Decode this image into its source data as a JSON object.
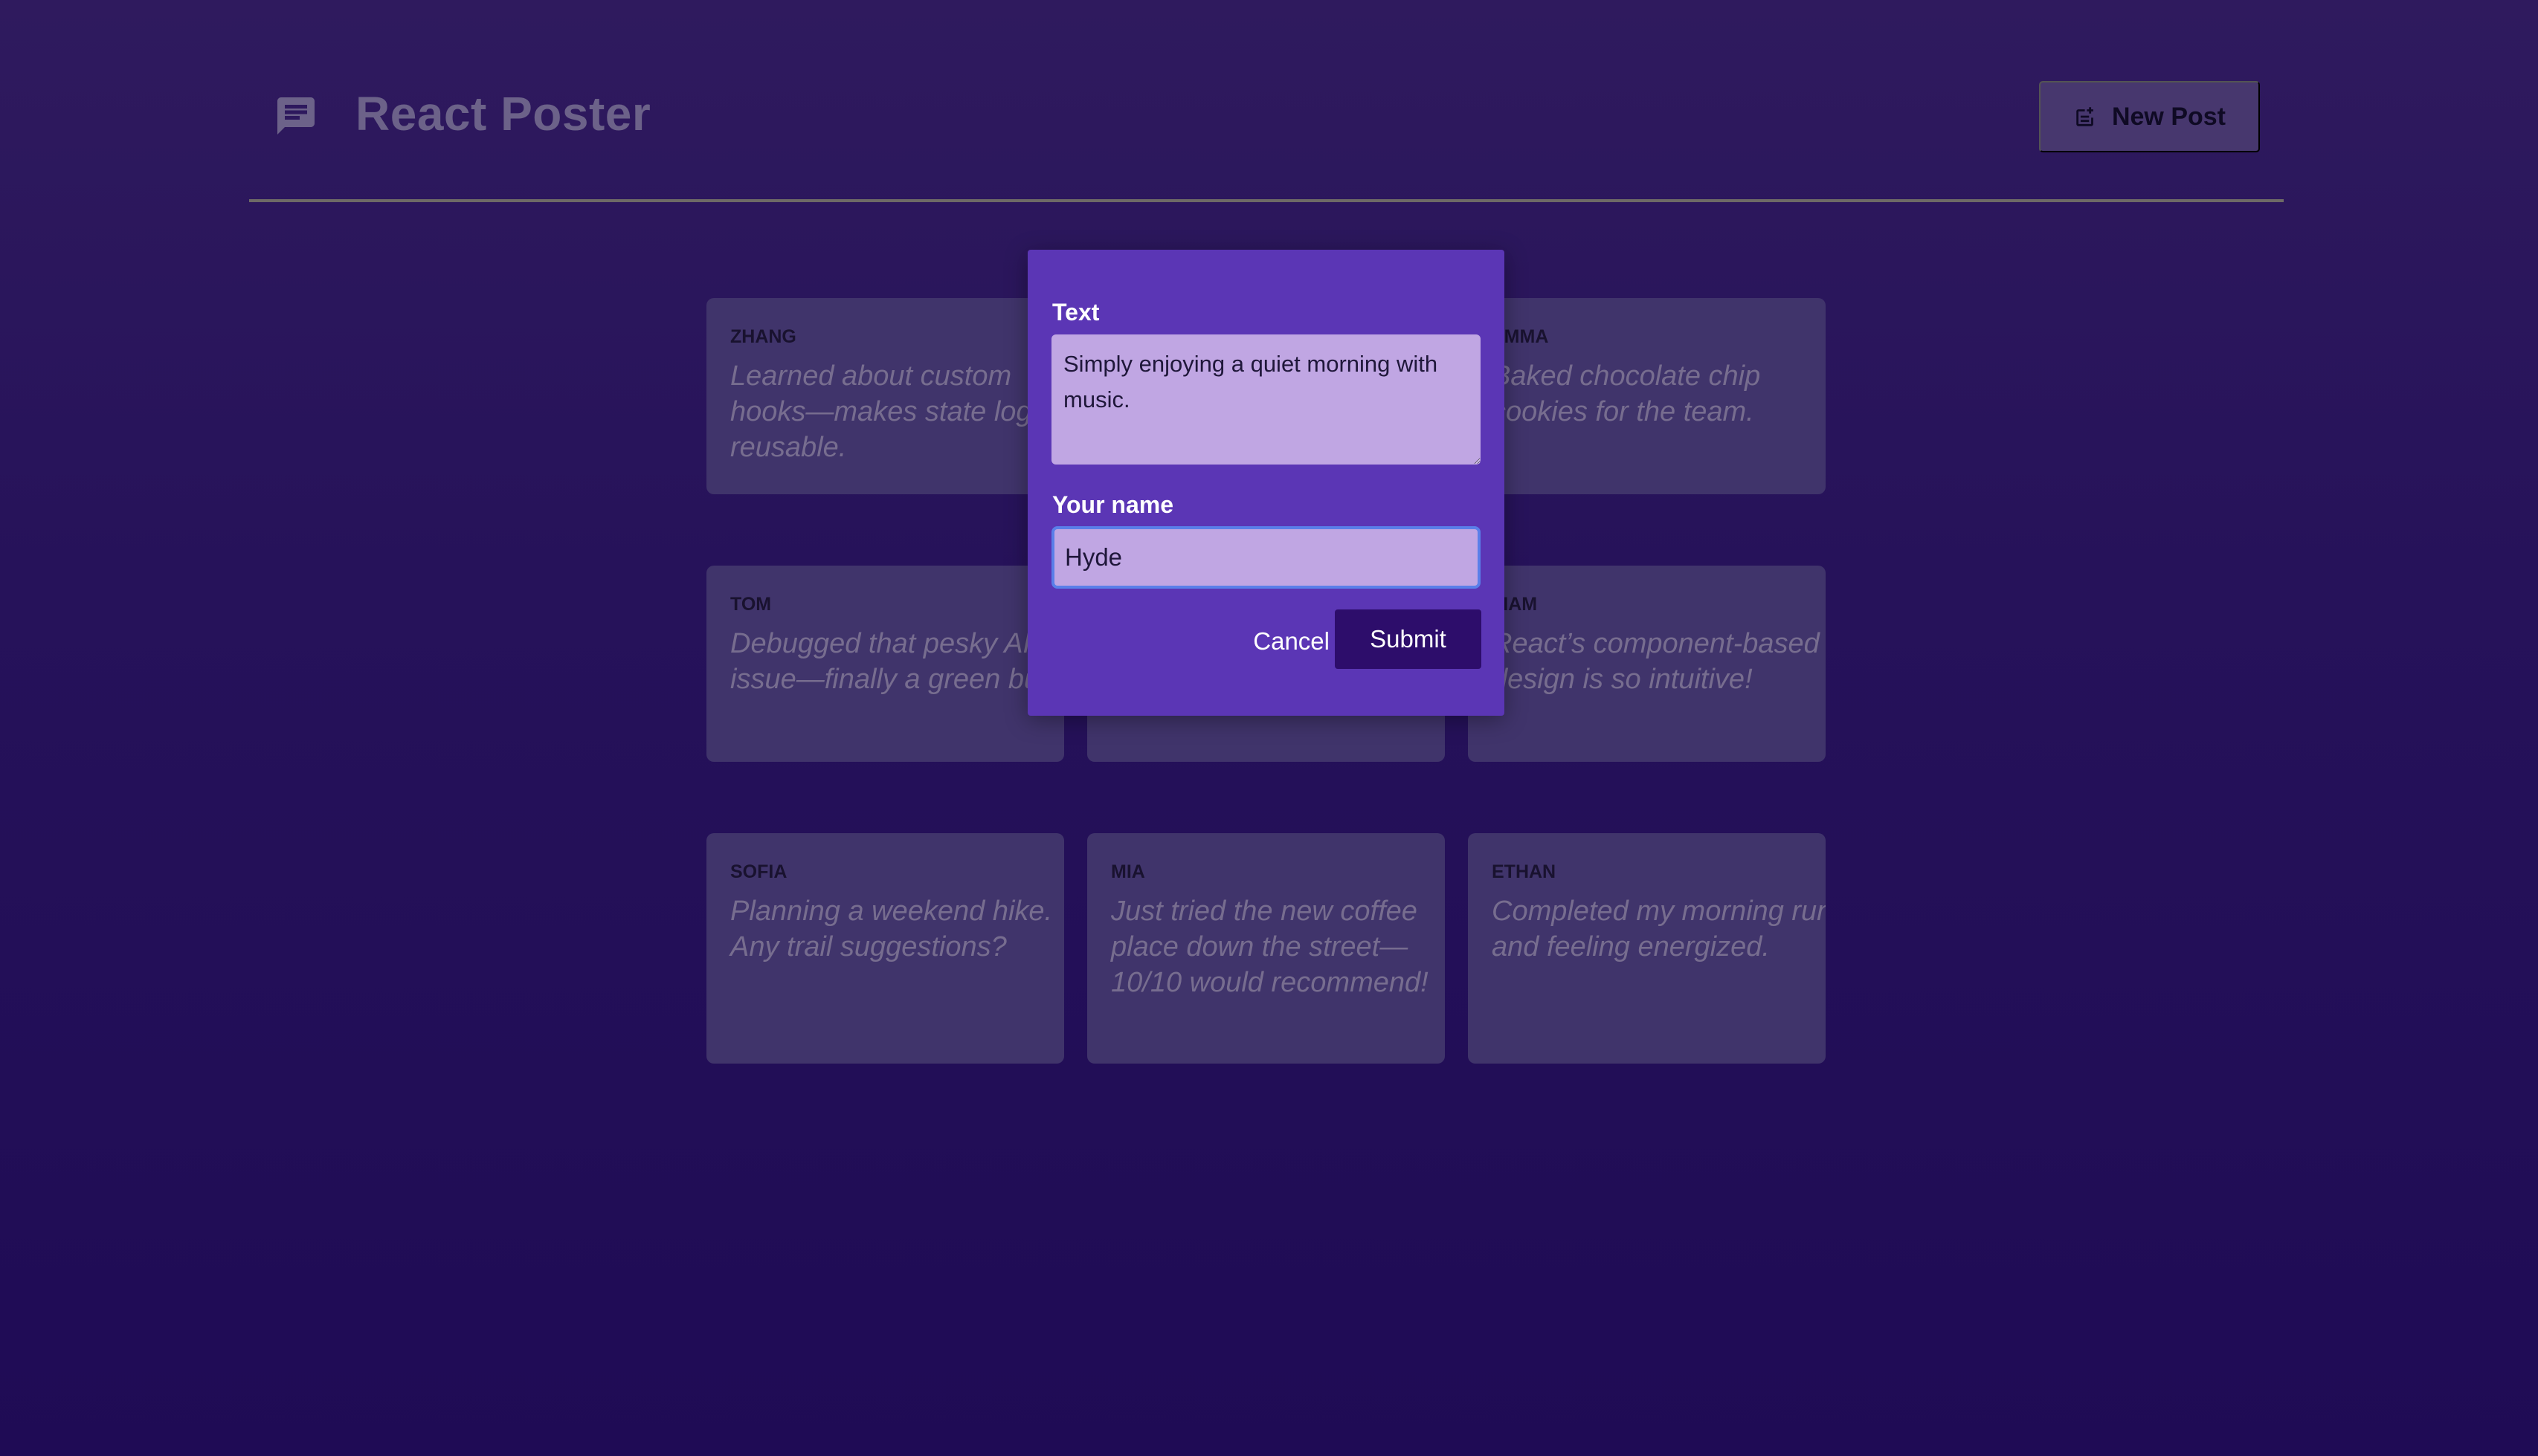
{
  "header": {
    "title": "React Poster",
    "logo_icon": "chat-bubble-icon",
    "new_post_label": "New Post",
    "new_post_icon": "note-add-icon"
  },
  "posts": [
    {
      "author": "ZHANG",
      "text": "Learned about custom hooks—makes state logic reusable."
    },
    {
      "author": "",
      "text": ""
    },
    {
      "author": "EMMA",
      "text": "Baked chocolate chip cookies for the team."
    },
    {
      "author": "TOM",
      "text": "Debugged that pesky API issue—finally a green build!"
    },
    {
      "author": "",
      "text": ""
    },
    {
      "author": "LIAM",
      "text": "React’s component-based design is so intuitive!"
    },
    {
      "author": "SOFIA",
      "text": "Planning a weekend hike. Any trail suggestions?"
    },
    {
      "author": "MIA",
      "text": "Just tried the new coffee place down the street—10/10 would recommend!"
    },
    {
      "author": "ETHAN",
      "text": "Completed my morning run and feeling energized."
    }
  ],
  "modal": {
    "text_label": "Text",
    "text_value": "Simply enjoying a quiet morning with music.",
    "name_label": "Your name",
    "name_value": "Hyde",
    "cancel_label": "Cancel",
    "submit_label": "Submit"
  },
  "colors": {
    "background": "#26125a",
    "modal": "#5b36b5",
    "submit": "#2d0d6b",
    "input_focus_border": "#5a7fe9"
  }
}
